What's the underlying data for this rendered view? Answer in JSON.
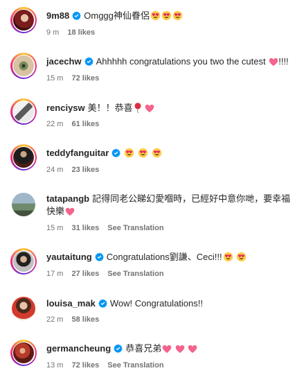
{
  "comments": [
    {
      "username": "9m88",
      "verified": true,
      "text": "Omggg神仙眷侶",
      "emoji": [
        "heart-eyes",
        "heart-eyes",
        "heart-eyes"
      ],
      "time": "9 m",
      "likes": "18 likes",
      "translate": ""
    },
    {
      "username": "jacechw",
      "verified": true,
      "text": "Ahhhhh congratulations you two the cutest",
      "emoji": [
        "pink-heart"
      ],
      "trail": "!!!!",
      "time": "15 m",
      "likes": "72 likes",
      "translate": ""
    },
    {
      "username": "renciysw",
      "verified": false,
      "text": "美！！恭喜",
      "emoji": [
        "balloon",
        "pink-heart"
      ],
      "time": "22 m",
      "likes": "61 likes",
      "translate": ""
    },
    {
      "username": "teddyfanguitar",
      "verified": true,
      "text": "",
      "emoji": [
        "heart-eyes",
        "heart-eyes",
        "heart-eyes"
      ],
      "time": "24 m",
      "likes": "23 likes",
      "translate": ""
    },
    {
      "username": "tatapangb",
      "verified": false,
      "text": "記得同老公睇幻愛嗰時，已經好中意你哋，要幸福",
      "line2": "快樂",
      "emoji2": [
        "pink-heart"
      ],
      "time": "15 m",
      "likes": "31 likes",
      "translate": "See Translation"
    },
    {
      "username": "yautaitung",
      "verified": true,
      "text": "Congratulations劉謙、Ceci!!!",
      "emoji": [
        "heart-eyes",
        "heart-eyes"
      ],
      "time": "17 m",
      "likes": "27 likes",
      "translate": "See Translation"
    },
    {
      "username": "louisa_mak",
      "verified": true,
      "text": "Wow! Congratulations!!",
      "emoji": [],
      "time": "22 m",
      "likes": "58 likes",
      "translate": ""
    },
    {
      "username": "germancheung",
      "verified": true,
      "text": "恭喜兄弟",
      "emoji": [
        "pink-heart",
        "pink-heart",
        "pink-heart"
      ],
      "time": "13 m",
      "likes": "72 likes",
      "translate": "See Translation"
    }
  ],
  "colors": {
    "verified": "#0095f6",
    "ring": "#ee2a7b",
    "meta": "#737373"
  }
}
